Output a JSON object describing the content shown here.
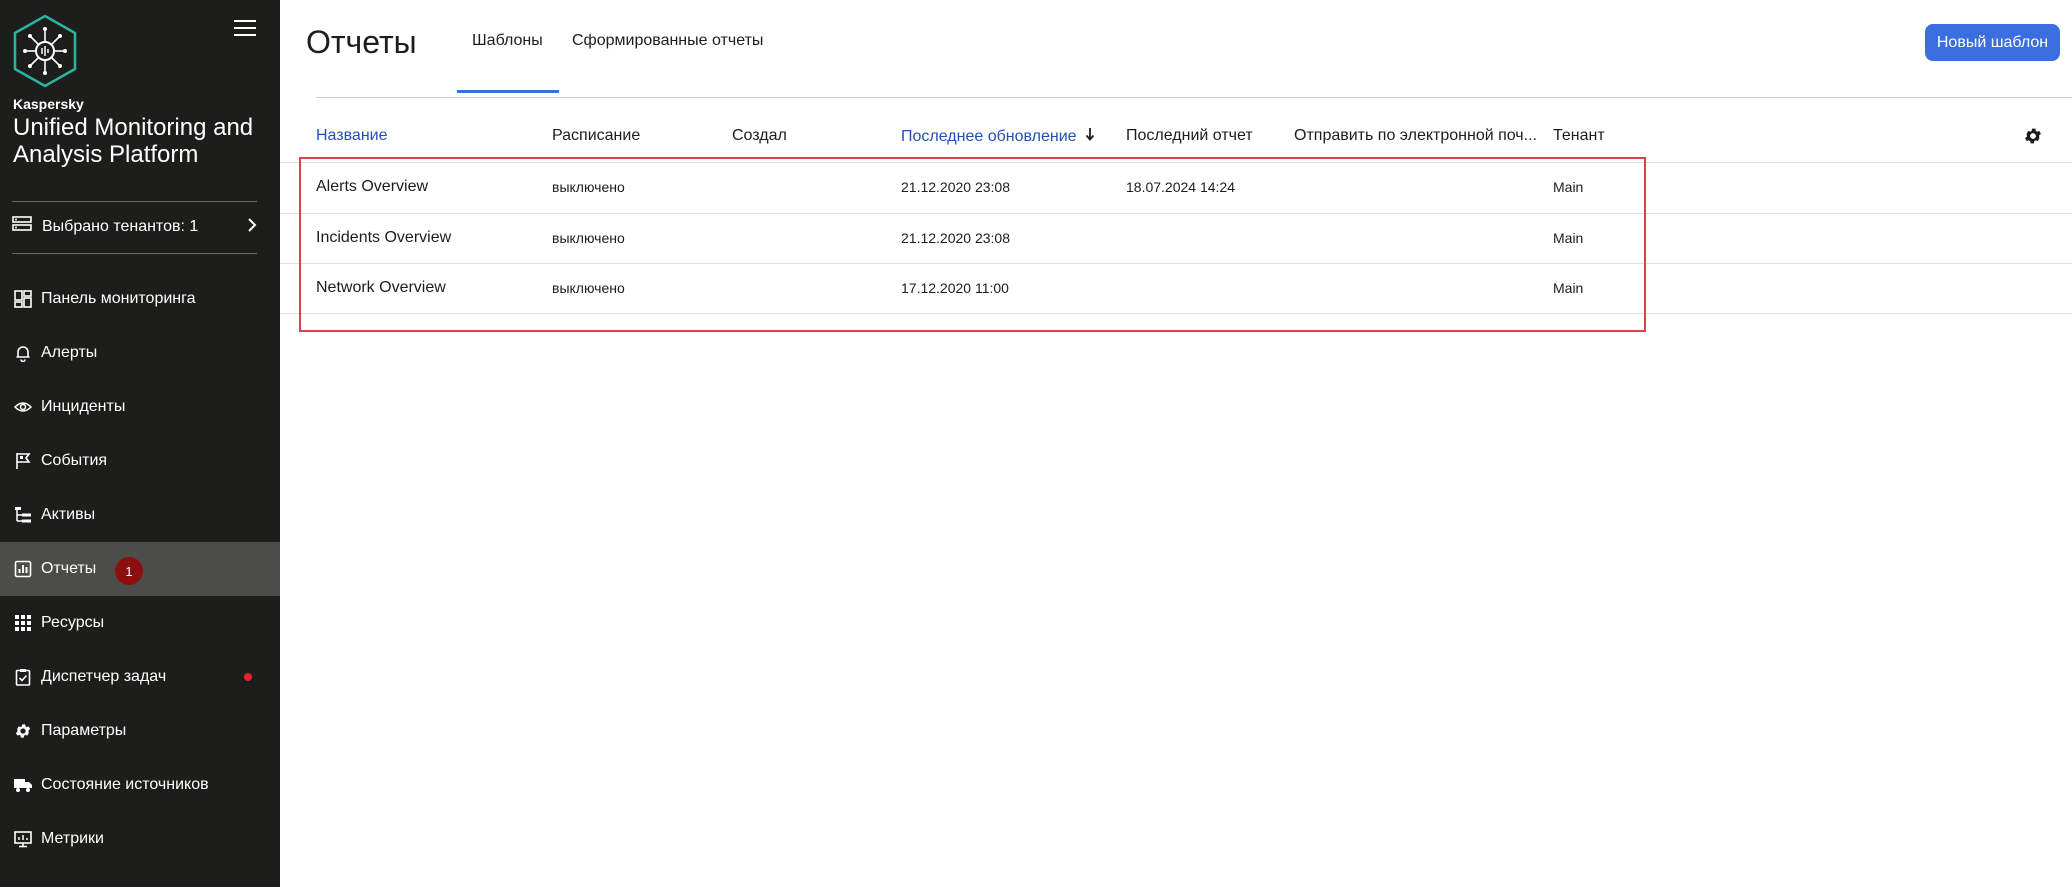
{
  "sidebar": {
    "vendor": "Kaspersky",
    "product": "Unified Monitoring and Analysis Platform",
    "tenants": "Выбрано тенантов: 1",
    "items": [
      {
        "label": "Панель мониторинга",
        "icon": "dashboard-icon"
      },
      {
        "label": "Алерты",
        "icon": "bell-icon"
      },
      {
        "label": "Инциденты",
        "icon": "eye-icon"
      },
      {
        "label": "События",
        "icon": "flag-icon"
      },
      {
        "label": "Активы",
        "icon": "asset-tree-icon"
      },
      {
        "label": "Отчеты",
        "icon": "report-icon",
        "active": true,
        "badge": "1"
      },
      {
        "label": "Ресурсы",
        "icon": "grid-icon"
      },
      {
        "label": "Диспетчер задач",
        "icon": "clipboard-icon",
        "status_dot": "#e8212c"
      },
      {
        "label": "Параметры",
        "icon": "gear-icon"
      },
      {
        "label": "Состояние источников",
        "icon": "truck-icon"
      },
      {
        "label": "Метрики",
        "icon": "monitor-icon"
      }
    ]
  },
  "main": {
    "title": "Отчеты",
    "tabs": [
      {
        "label": "Шаблоны",
        "active": true
      },
      {
        "label": "Сформированные отчеты",
        "active": false
      }
    ],
    "new_button": "Новый шаблон",
    "columns": [
      "Название",
      "Расписание",
      "Создал",
      "Последнее обновление",
      "Последний отчет",
      "Отправить по электронной поч...",
      "Тенант"
    ],
    "rows": [
      {
        "name": "Alerts Overview",
        "schedule": "выключено",
        "created_by": "",
        "updated": "21.12.2020 23:08",
        "last_report": "18.07.2024 14:24",
        "email": "",
        "tenant": "Main"
      },
      {
        "name": "Incidents Overview",
        "schedule": "выключено",
        "created_by": "",
        "updated": "21.12.2020 23:08",
        "last_report": "",
        "email": "",
        "tenant": "Main"
      },
      {
        "name": "Network Overview",
        "schedule": "выключено",
        "created_by": "",
        "updated": "17.12.2020 11:00",
        "last_report": "",
        "email": "",
        "tenant": "Main"
      }
    ]
  },
  "colors": {
    "sidebar_bg": "#1d1d1b",
    "accent": "#3b6fe0",
    "link": "#2450b5",
    "badge": "#8c0f0f",
    "highlight": "#d6434b"
  }
}
